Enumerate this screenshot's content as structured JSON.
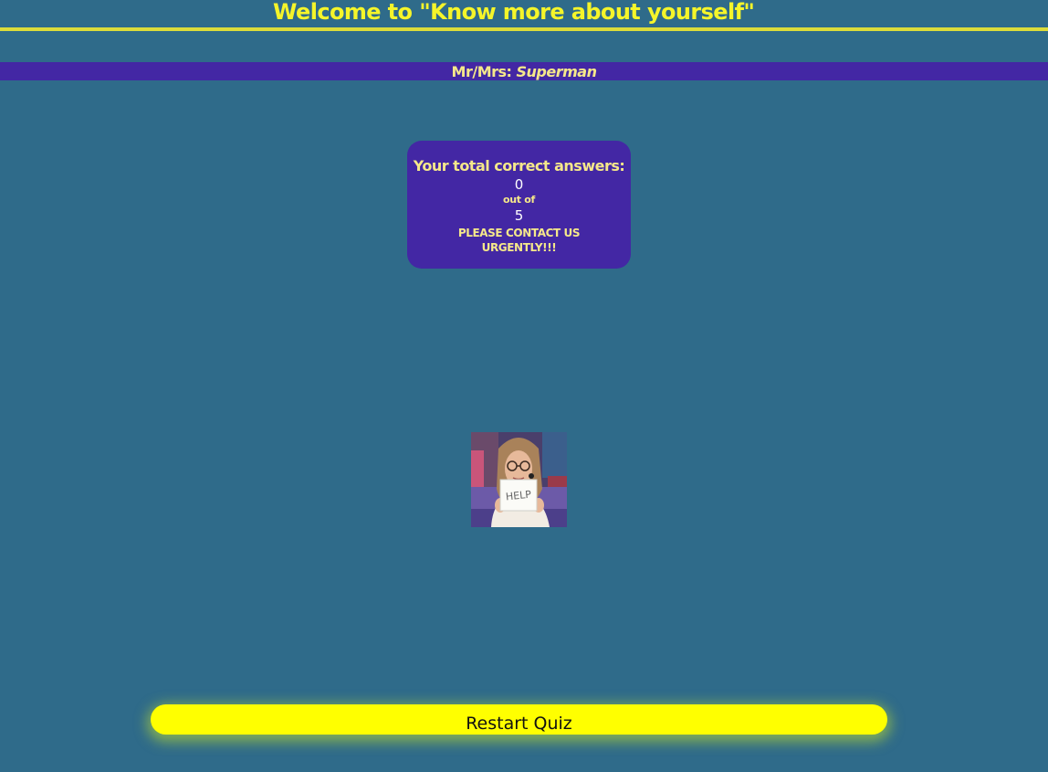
{
  "header": {
    "title": "Welcome to \"Know more about yourself\""
  },
  "user": {
    "prefix": "Mr/Mrs:",
    "name": "Superman"
  },
  "result": {
    "heading": "Your total correct answers:",
    "correct": "0",
    "out_of_label": "out of",
    "total": "5",
    "message": "PLEASE CONTACT US URGENTLY!!!"
  },
  "image": {
    "sign_text": "HELP",
    "icon": "help-sign-gif"
  },
  "actions": {
    "restart_label": "Restart Quiz"
  },
  "colors": {
    "background": "#2f6b8a",
    "panel": "#4327a4",
    "accent_yellow": "#ffff00",
    "title_yellow": "#f5f52a",
    "text_cream": "#f5e88a"
  }
}
